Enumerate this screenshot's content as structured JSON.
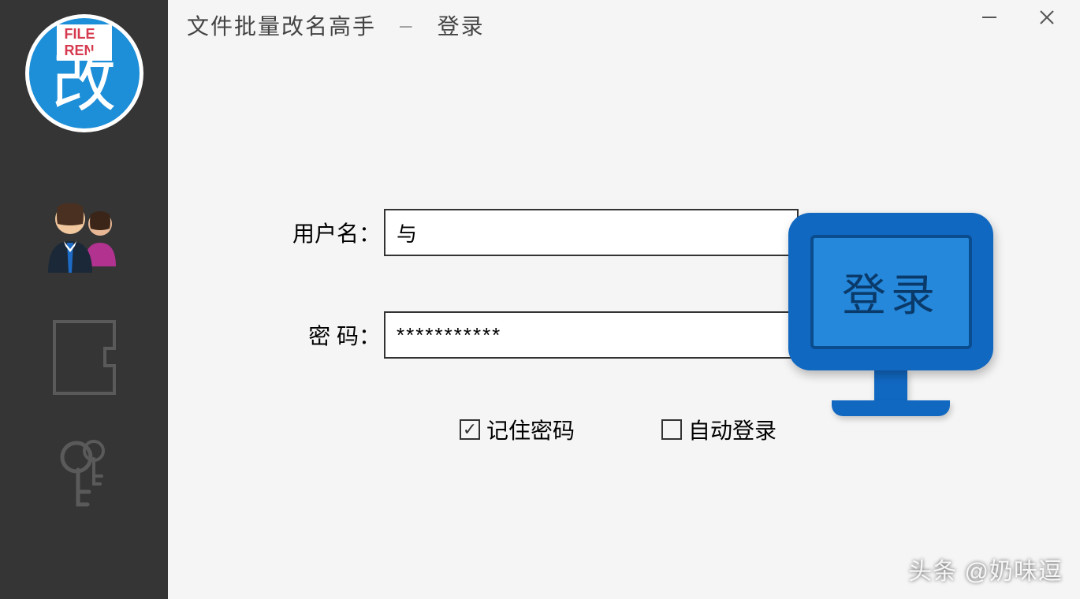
{
  "window": {
    "app_name": "文件批量改名高手",
    "separator": "–",
    "page": "登录"
  },
  "logo": {
    "banner": "FILE REN",
    "character": "改"
  },
  "form": {
    "username_label": "用户名：",
    "username_value": "与",
    "password_label": "密  码：",
    "password_value": "***********",
    "remember_label": "记住密码",
    "remember_checked": true,
    "autologin_label": "自动登录",
    "autologin_checked": false
  },
  "login_button": {
    "label": "登录"
  },
  "watermark": "头条 @奶味逗"
}
